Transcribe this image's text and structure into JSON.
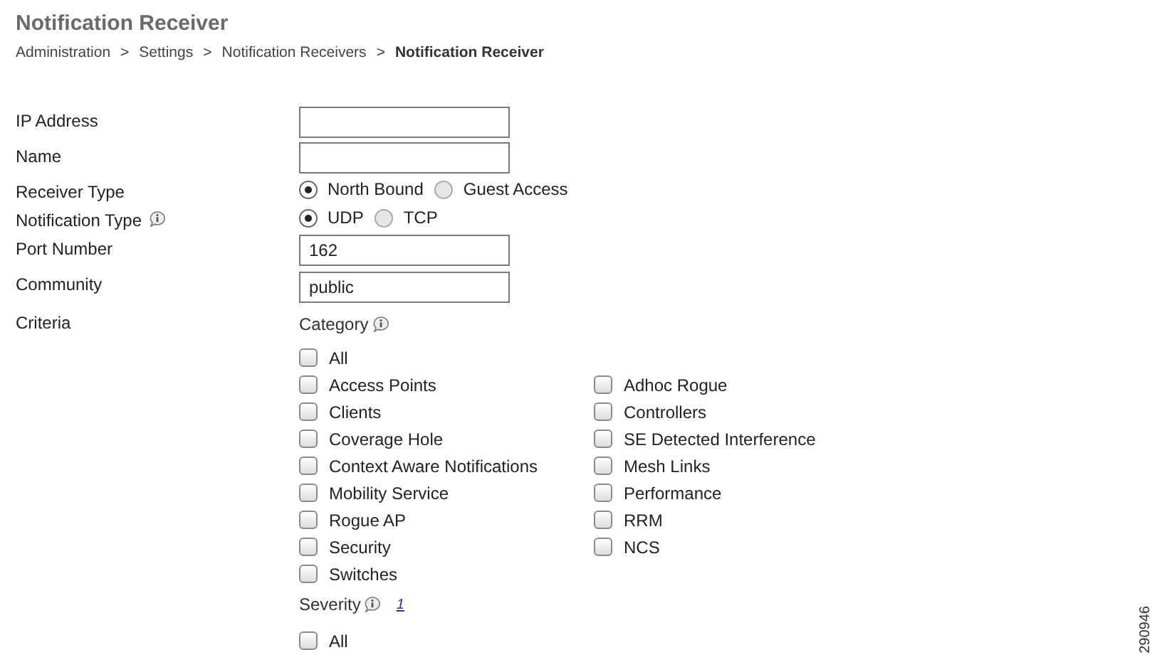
{
  "title": "Notification Receiver",
  "breadcrumb": [
    {
      "label": "Administration",
      "current": false
    },
    {
      "label": "Settings",
      "current": false
    },
    {
      "label": "Notification Receivers",
      "current": false
    },
    {
      "label": "Notification Receiver",
      "current": true
    }
  ],
  "breadcrumb_separator": ">",
  "fields": [
    {
      "kind": "text",
      "label": "IP Address"
    },
    {
      "kind": "text",
      "label": "Name"
    },
    {
      "kind": "radio",
      "label": "Receiver Type",
      "info": false,
      "options": [
        {
          "label": "North Bound",
          "selected": true
        },
        {
          "label": "Guest Access",
          "selected": false
        }
      ]
    },
    {
      "kind": "radio",
      "label": "Notification Type",
      "info": true,
      "options": [
        {
          "label": "UDP",
          "selected": true
        },
        {
          "label": "TCP",
          "selected": false
        }
      ]
    },
    {
      "kind": "text",
      "label": "Port Number",
      "value": "162"
    },
    {
      "kind": "text",
      "label": "Community",
      "value": "public"
    }
  ],
  "criteria": {
    "label": "Criteria",
    "category": {
      "label": "Category",
      "all": {
        "label": "All",
        "checked": false
      },
      "options": [
        {
          "label": "Access Points",
          "checked": false
        },
        {
          "label": "Clients",
          "checked": false
        },
        {
          "label": "Coverage Hole",
          "checked": false
        },
        {
          "label": "Context Aware Notifications",
          "checked": false
        },
        {
          "label": "Mobility Service",
          "checked": false
        },
        {
          "label": "Rogue AP",
          "checked": false
        },
        {
          "label": "Security",
          "checked": false
        },
        {
          "label": "Switches",
          "checked": false
        },
        {
          "label": "Adhoc Rogue",
          "checked": false
        },
        {
          "label": "Controllers",
          "checked": false
        },
        {
          "label": "SE Detected Interference",
          "checked": false
        },
        {
          "label": "Mesh Links",
          "checked": false
        },
        {
          "label": "Performance",
          "checked": false
        },
        {
          "label": "RRM",
          "checked": false
        },
        {
          "label": "NCS",
          "checked": false
        }
      ]
    },
    "severity": {
      "label": "Severity",
      "link": "1",
      "all": {
        "label": "All",
        "checked": false
      }
    }
  },
  "figure_id": "290946"
}
